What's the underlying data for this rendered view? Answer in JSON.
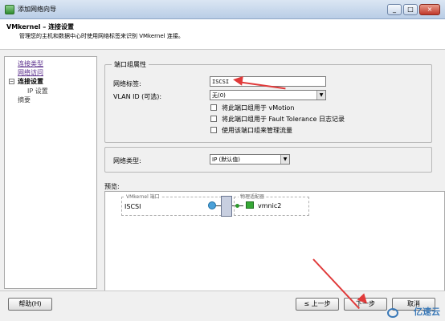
{
  "window": {
    "title": "添加网络向导",
    "buttons": [
      "_",
      "□",
      "×"
    ]
  },
  "header": {
    "title": "VMkernel – 连接设置",
    "subtitle": "管理您的主机和数据中心时使用网络标签来识别 VMkernel 连接。"
  },
  "nav": {
    "items": [
      {
        "label": "连接类型"
      },
      {
        "label": "网络访问"
      },
      {
        "label": "连接设置"
      },
      {
        "label": "IP 设置"
      },
      {
        "label": "摘要"
      }
    ],
    "toggle": "−"
  },
  "port_group": {
    "title": "端口组属性",
    "network_label_label": "网络标签:",
    "network_label_value": "ISCSI",
    "vlan_label": "VLAN ID (可选):",
    "vlan_value": "无(0)",
    "checkbox_vmotion": "将此端口组用于 vMotion",
    "checkbox_ft": "将此端口组用于 Fault Tolerance 日志记录",
    "checkbox_mgmt": "使用该端口组来管理流量"
  },
  "network_type": {
    "label": "网络类型:",
    "value": "IP (默认值)"
  },
  "preview": {
    "label": "预览:",
    "vmkernel_port_title": "VMkernel 端口",
    "port_name": "ISCSI",
    "physical_adapters_title": "物理适配器",
    "nic_name": "vmnic2"
  },
  "footer": {
    "help": "帮助(H)",
    "back": "≤ 上一步",
    "next": "下一步",
    "cancel": "取消"
  },
  "watermark": {
    "text": "亿速云"
  },
  "colors": {
    "accent_arrow": "#e03a3a",
    "link_visited": "#5a2e8c"
  }
}
